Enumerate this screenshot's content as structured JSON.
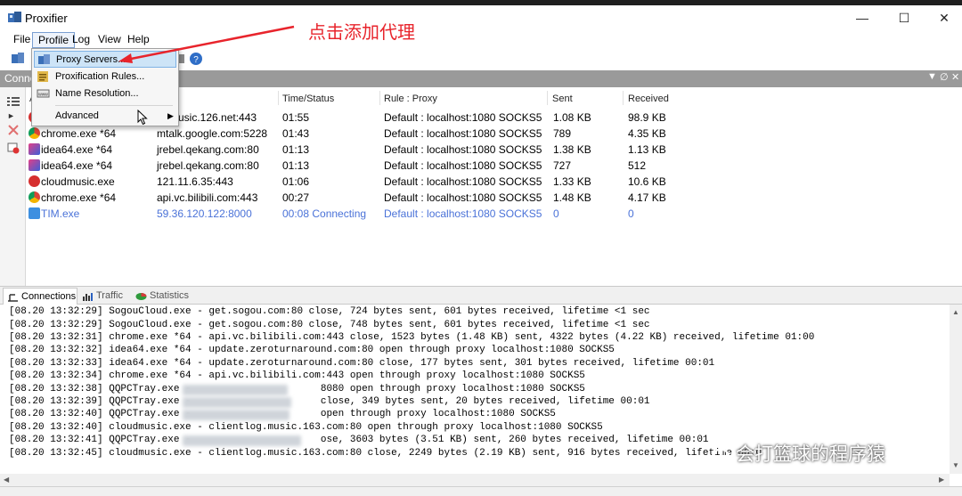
{
  "window": {
    "title": "Proxifier"
  },
  "menu": {
    "file": "File",
    "profile": "Profile",
    "log": "Log",
    "view": "View",
    "help": "Help"
  },
  "dropdown": {
    "proxy_servers": "Proxy Servers...",
    "proxification_rules": "Proxification Rules...",
    "name_resolution": "Name Resolution...",
    "advanced": "Advanced"
  },
  "connections_panel": {
    "label": "Conne"
  },
  "columns": {
    "app_partial": "A",
    "time_status": "Time/Status",
    "rule_proxy": "Rule : Proxy",
    "sent": "Sent",
    "received": "Received"
  },
  "rows": [
    {
      "app": "",
      "target": "usic.126.net:443",
      "time": "01:55",
      "rule": "Default : localhost:1080 SOCKS5",
      "sent": "1.08 KB",
      "received": "98.9 KB"
    },
    {
      "app": "chrome.exe *64",
      "target": "mtalk.google.com:5228",
      "time": "01:43",
      "rule": "Default : localhost:1080 SOCKS5",
      "sent": "789",
      "received": "4.35 KB"
    },
    {
      "app": "idea64.exe *64",
      "target": "jrebel.qekang.com:80",
      "time": "01:13",
      "rule": "Default : localhost:1080 SOCKS5",
      "sent": "1.38 KB",
      "received": "1.13 KB"
    },
    {
      "app": "idea64.exe *64",
      "target": "jrebel.qekang.com:80",
      "time": "01:13",
      "rule": "Default : localhost:1080 SOCKS5",
      "sent": "727",
      "received": "512"
    },
    {
      "app": "cloudmusic.exe",
      "target": "121.11.6.35:443",
      "time": "01:06",
      "rule": "Default : localhost:1080 SOCKS5",
      "sent": "1.33 KB",
      "received": "10.6 KB"
    },
    {
      "app": "chrome.exe *64",
      "target": "api.vc.bilibili.com:443",
      "time": "00:27",
      "rule": "Default : localhost:1080 SOCKS5",
      "sent": "1.48 KB",
      "received": "4.17 KB"
    },
    {
      "app": "TIM.exe",
      "target": "59.36.120.122:8000",
      "time": "00:08 Connecting",
      "rule": "Default : localhost:1080 SOCKS5",
      "sent": "0",
      "received": "0"
    }
  ],
  "tabs": {
    "connections": "Connections",
    "traffic": "Traffic",
    "statistics": "Statistics"
  },
  "log_lines": [
    "[08.20 13:32:29] SogouCloud.exe - get.sogou.com:80 close, 724 bytes sent, 601 bytes received, lifetime <1 sec",
    "[08.20 13:32:29] SogouCloud.exe - get.sogou.com:80 close, 748 bytes sent, 601 bytes received, lifetime <1 sec",
    "[08.20 13:32:31] chrome.exe *64 - api.vc.bilibili.com:443 close, 1523 bytes (1.48 KB) sent, 4322 bytes (4.22 KB) received, lifetime 01:00",
    "[08.20 13:32:32] idea64.exe *64 - update.zeroturnaround.com:80 open through proxy localhost:1080 SOCKS5",
    "[08.20 13:32:33] idea64.exe *64 - update.zeroturnaround.com:80 close, 177 bytes sent, 301 bytes received, lifetime 00:01",
    "[08.20 13:32:34] chrome.exe *64 - api.vc.bilibili.com:443 open through proxy localhost:1080 SOCKS5",
    "[08.20 13:32:38] QQPCTray.exe -                      8080 open through proxy localhost:1080 SOCKS5",
    "[08.20 13:32:39] QQPCTray.exe -                      close, 349 bytes sent, 20 bytes received, lifetime 00:01",
    "[08.20 13:32:40] QQPCTray.exe -                      open through proxy localhost:1080 SOCKS5",
    "[08.20 13:32:40] cloudmusic.exe - clientlog.music.163.com:80 open through proxy localhost:1080 SOCKS5",
    "[08.20 13:32:41] QQPCTray.exe -                      ose, 3603 bytes (3.51 KB) sent, 260 bytes received, lifetime 00:01",
    "[08.20 13:32:45] cloudmusic.exe - clientlog.music.163.com:80 close, 2249 bytes (2.19 KB) sent, 916 bytes received, lifetime 00:0"
  ],
  "annotation": {
    "text": "点击添加代理"
  },
  "watermark": {
    "text": "会打篮球的程序猿"
  },
  "colors": {
    "accent_red": "#e8242c",
    "connecting_blue": "#4a72d8",
    "header_gray": "#9a9a9a"
  }
}
